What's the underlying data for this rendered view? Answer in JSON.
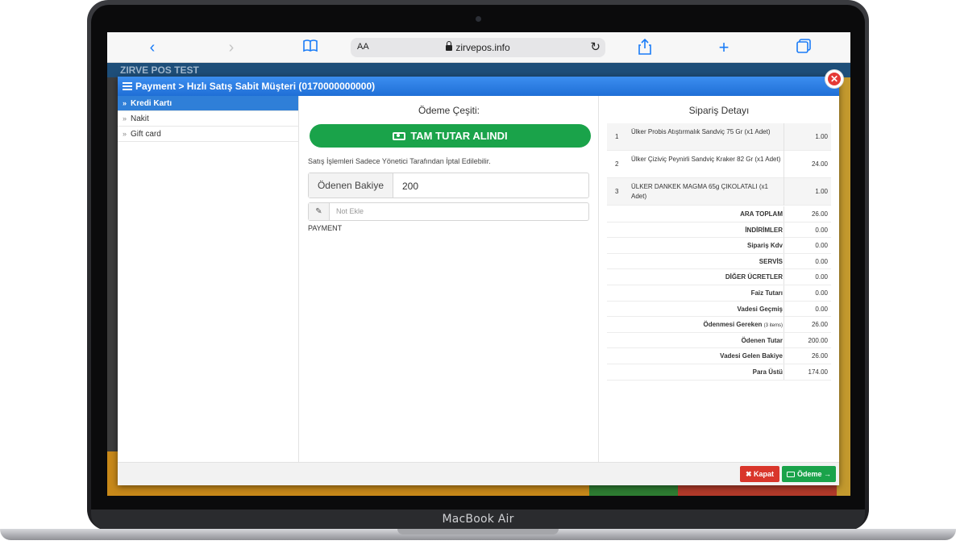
{
  "device": {
    "label": "MacBook Air"
  },
  "browser": {
    "text_size_label": "AA",
    "url": "zirvepos.info"
  },
  "background_app": {
    "title": "ZIRVE POS TEST"
  },
  "modal": {
    "title": "Payment > Hızlı Satış Sabit Müşteri (0170000000000)",
    "methods": [
      {
        "label": "Kredi Kartı",
        "active": true
      },
      {
        "label": "Nakit",
        "active": false
      },
      {
        "label": "Gift card",
        "active": false
      }
    ],
    "payment": {
      "heading": "Ödeme Çeşiti:",
      "full_amount_button": "TAM TUTAR ALINDI",
      "notice": "Satış İşlemleri Sadece Yönetici Tarafından İptal Edilebilir.",
      "balance_label": "Ödenen Bakiye",
      "balance_value": "200",
      "note_placeholder": "Not Ekle",
      "type_label": "PAYMENT"
    },
    "order": {
      "heading": "Sipariş Detayı",
      "items": [
        {
          "no": "1",
          "name": "Ülker Probis Atıştırmalık Sandviç 75 Gr (x1 Adet)",
          "qty": "1.00"
        },
        {
          "no": "2",
          "name": "Ülker Çiziviç Peynirli Sandviç Kraker 82 Gr (x1 Adet)",
          "qty": "24.00"
        },
        {
          "no": "3",
          "name": "ÜLKER DANKEK MAGMA 65g ÇIKOLATALI (x1 Adet)",
          "qty": "1.00"
        }
      ],
      "totals": [
        {
          "label": "ARA TOPLAM",
          "note": "",
          "value": "26.00"
        },
        {
          "label": "İNDİRİMLER",
          "note": "",
          "value": "0.00"
        },
        {
          "label": "Sipariş Kdv",
          "note": "",
          "value": "0.00"
        },
        {
          "label": "SERVİS",
          "note": "",
          "value": "0.00"
        },
        {
          "label": "DİĞER ÜCRETLER",
          "note": "",
          "value": "0.00"
        },
        {
          "label": "Faiz Tutarı",
          "note": "",
          "value": "0.00"
        },
        {
          "label": "Vadesi Geçmiş",
          "note": "",
          "value": "0.00"
        },
        {
          "label": "Ödenmesi Gereken",
          "note": "(3 items)",
          "value": "26.00"
        },
        {
          "label": "Ödenen Tutar",
          "note": "",
          "value": "200.00"
        },
        {
          "label": "Vadesi Gelen Bakiye",
          "note": "",
          "value": "26.00"
        },
        {
          "label": "Para Üstü",
          "note": "",
          "value": "174.00"
        }
      ]
    },
    "footer": {
      "close_label": "Kapat",
      "pay_label": "Ödeme →"
    }
  },
  "colors": {
    "header_blue": "#2f7fd8",
    "success_green": "#1aa34a",
    "danger_red": "#d9362b"
  }
}
